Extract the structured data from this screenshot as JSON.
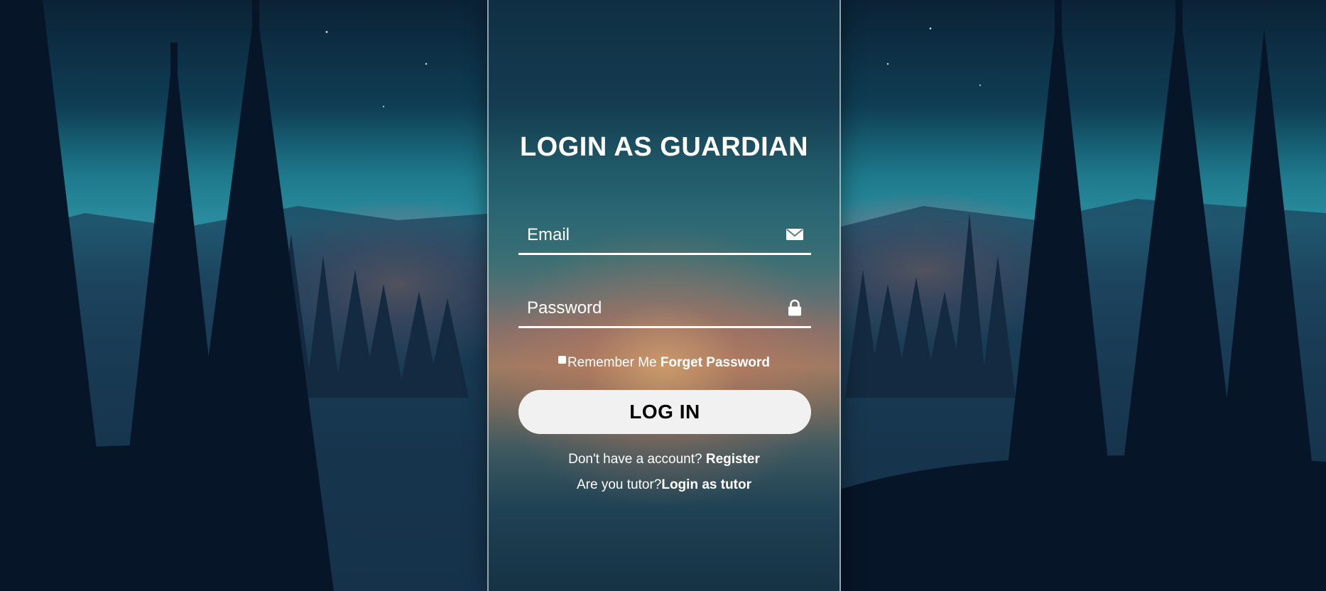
{
  "login": {
    "title": "LOGIN AS GUARDIAN",
    "email_placeholder": "Email",
    "password_placeholder": "Password",
    "remember_label": "Remember Me",
    "forgot_label": "Forget Password",
    "button_label": "LOG IN",
    "register_prompt": "Don't have a account?",
    "register_link": "Register",
    "tutor_prompt": "Are you tutor?",
    "tutor_link": "Login as tutor"
  },
  "icons": {
    "email": "envelope-icon",
    "password": "lock-icon"
  },
  "colors": {
    "text": "#ffffff",
    "button_bg": "#f1f1f1",
    "button_text": "#000000"
  }
}
